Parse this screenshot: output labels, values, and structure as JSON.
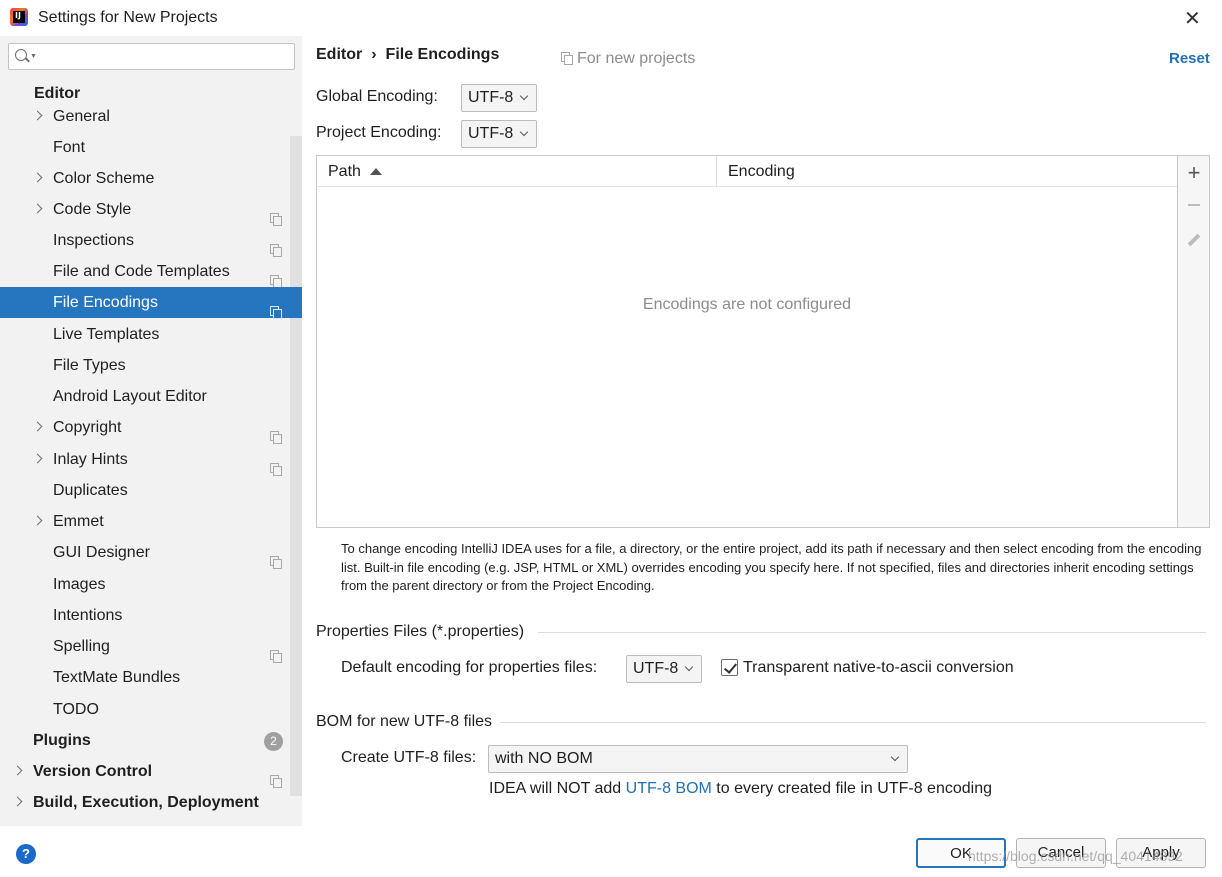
{
  "window": {
    "title": "Settings for New Projects"
  },
  "search": {
    "placeholder": ""
  },
  "tree": {
    "editor": "Editor",
    "items": [
      "General",
      "Font",
      "Color Scheme",
      "Code Style",
      "Inspections",
      "File and Code Templates",
      "File Encodings",
      "Live Templates",
      "File Types",
      "Android Layout Editor",
      "Copyright",
      "Inlay Hints",
      "Duplicates",
      "Emmet",
      "GUI Designer",
      "Images",
      "Intentions",
      "Spelling",
      "TextMate Bundles",
      "TODO"
    ],
    "plugins": "Plugins",
    "plugins_badge": "2",
    "version_control": "Version Control",
    "build": "Build, Execution, Deployment"
  },
  "breadcrumb": {
    "parent": "Editor",
    "separator": "›",
    "current": "File Encodings"
  },
  "scope_hint": "For new projects",
  "reset_label": "Reset",
  "global_encoding": {
    "label": "Global Encoding:",
    "value": "UTF-8"
  },
  "project_encoding": {
    "label": "Project Encoding:",
    "value": "UTF-8"
  },
  "table": {
    "columns": [
      "Path",
      "Encoding"
    ],
    "empty_text": "Encodings are not configured"
  },
  "help_text": "To change encoding IntelliJ IDEA uses for a file, a directory, or the entire project, add its path if necessary and then select encoding from the encoding list. Built-in file encoding (e.g. JSP, HTML or XML) overrides encoding you specify here. If not specified, files and directories inherit encoding settings from the parent directory or from the Project Encoding.",
  "properties": {
    "section_title": "Properties Files (*.properties)",
    "default_label": "Default encoding for properties files:",
    "default_value": "UTF-8",
    "transparent_label": "Transparent native-to-ascii conversion",
    "transparent_checked": true
  },
  "bom": {
    "section_title": "BOM for new UTF-8 files",
    "create_label": "Create UTF-8 files:",
    "create_value": "with NO BOM",
    "note_before": "IDEA will NOT add ",
    "note_link": "UTF-8 BOM",
    "note_after": " to every created file in UTF-8 encoding"
  },
  "buttons": {
    "ok": "OK",
    "cancel": "Cancel",
    "apply": "Apply"
  },
  "watermark": "https://blog.csdn.net/qq_40414892",
  "colors": {
    "accent": "#2675bf",
    "link": "#2470b3",
    "sidebar_bg": "#f2f2f2"
  }
}
